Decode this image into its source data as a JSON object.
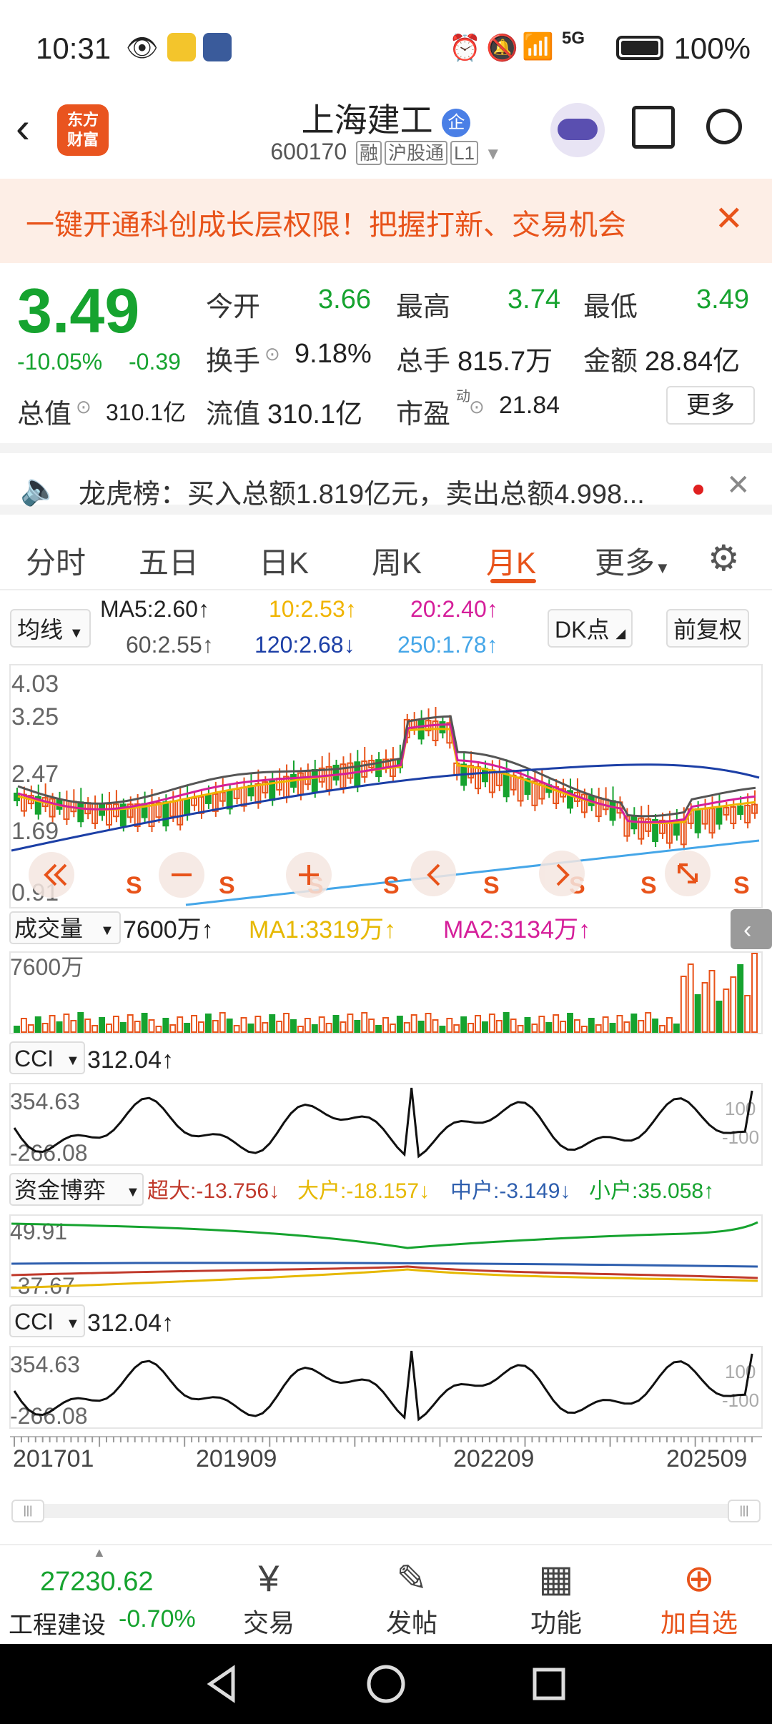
{
  "status_bar": {
    "time": "10:31",
    "battery": "100%",
    "network": "5G"
  },
  "header": {
    "logo_text": "东方\n财富",
    "stock_name": "上海建工",
    "badge": "企",
    "code": "600170",
    "tags": [
      "融",
      "沪股通",
      "L1"
    ]
  },
  "banner": {
    "text": "一键开通科创成长层权限！把握打新、交易机会"
  },
  "quote": {
    "price": "3.49",
    "change_pct": "-10.05%",
    "change": "-0.39",
    "open_label": "今开",
    "open": "3.66",
    "high_label": "最高",
    "high": "3.74",
    "low_label": "最低",
    "low": "3.49",
    "turnover_label": "换手",
    "turnover": "9.18%",
    "volume_label": "总手",
    "volume": "815.7万",
    "amount_label": "金额",
    "amount": "28.84亿",
    "mktcap_label": "总值",
    "mktcap": "310.1亿",
    "float_label": "流值",
    "float_cap": "310.1亿",
    "pe_label": "市盈",
    "pe_sup": "动",
    "pe": "21.84",
    "more_label": "更多"
  },
  "notice": {
    "text": "龙虎榜：买入总额1.819亿元，卖出总额4.998..."
  },
  "tabs": [
    "分时",
    "五日",
    "日K",
    "周K",
    "月K",
    "更多"
  ],
  "active_tab": "月K",
  "ma_row": {
    "selector": "均线",
    "ma5": "MA5:2.60↑",
    "ma10": "10:2.53↑",
    "ma20": "20:2.40↑",
    "ma60": "60:2.55↑",
    "ma120": "120:2.68↓",
    "ma250": "250:1.78↑",
    "dk_label": "DK点",
    "adjust_label": "前复权"
  },
  "price_axis": [
    "4.03",
    "3.25",
    "2.47",
    "1.69",
    "0.91"
  ],
  "volume_panel": {
    "selector": "成交量",
    "value": "7600万↑",
    "ma1": "MA1:3319万↑",
    "ma2": "MA2:3134万↑",
    "axis_top": "7600万"
  },
  "cci_panel": {
    "selector": "CCI",
    "value": "312.04↑",
    "axis_top": "354.63",
    "axis_bottom": "-266.08",
    "ref_hi": "100",
    "ref_lo": "-100"
  },
  "fund_panel": {
    "selector": "资金博弈",
    "super": "超大:-13.756↓",
    "large": "大户:-18.157↓",
    "mid": "中户:-3.149↓",
    "small": "小户:35.058↑",
    "axis_top": "49.91",
    "axis_bottom": "-37.67"
  },
  "cci_panel2": {
    "selector": "CCI",
    "value": "312.04↑",
    "axis_top": "354.63",
    "axis_bottom": "-266.08",
    "ref_hi": "100",
    "ref_lo": "-100"
  },
  "x_axis": [
    "201701",
    "201909",
    "202209",
    "202509"
  ],
  "signals": [
    "S",
    "S",
    "S",
    "S",
    "S",
    "S",
    "S",
    "S"
  ],
  "bottom_bar": {
    "index_value": "27230.62",
    "index_name": "工程建设",
    "index_change": "-0.70%",
    "trade": "交易",
    "post": "发帖",
    "func": "功能",
    "add": "加自选"
  },
  "colors": {
    "up": "#e8531a",
    "down": "#16a32f",
    "accent": "#e8531a"
  }
}
